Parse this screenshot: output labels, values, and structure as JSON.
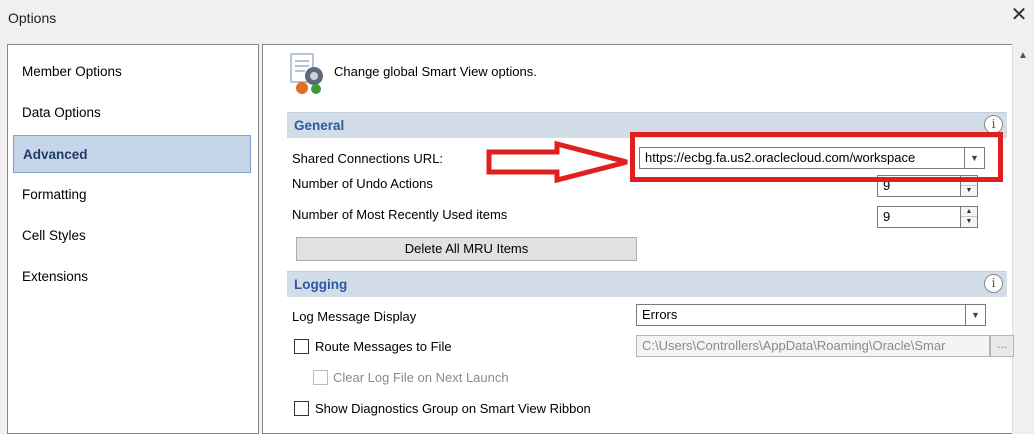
{
  "window": {
    "title": "Options"
  },
  "nav": {
    "items": [
      {
        "label": "Member Options"
      },
      {
        "label": "Data Options"
      },
      {
        "label": "Advanced"
      },
      {
        "label": "Formatting"
      },
      {
        "label": "Cell Styles"
      },
      {
        "label": "Extensions"
      }
    ],
    "selected_index": 2
  },
  "content": {
    "header_text": "Change global Smart View options.",
    "general": {
      "title": "General",
      "shared_connections_label": "Shared Connections URL:",
      "shared_connections_value": "https://ecbg.fa.us2.oraclecloud.com/workspace",
      "undo_label": "Number of Undo Actions",
      "undo_value": "9",
      "mru_label": "Number of Most Recently Used items",
      "mru_value": "9",
      "delete_mru_button": "Delete All MRU Items"
    },
    "logging": {
      "title": "Logging",
      "log_display_label": "Log Message Display",
      "log_display_value": "Errors",
      "route_label": "Route Messages to File",
      "route_checked": false,
      "route_path": "C:\\Users\\Controllers\\AppData\\Roaming\\Oracle\\Smar",
      "ellipsis": "...",
      "clear_label": "Clear Log File on Next Launch",
      "clear_checked": false,
      "diagnostics_label": "Show Diagnostics Group on Smart View Ribbon",
      "diagnostics_checked": false
    }
  },
  "colors": {
    "annotation_red": "#e02020",
    "section_header_bg": "#d3dde8",
    "section_title": "#2a5aa0",
    "selected_nav_bg": "#c6d6ea"
  },
  "icons": {
    "close": "close-icon",
    "options_header": "smart-view-options-icon",
    "info": "info-icon",
    "dropdown": "chevron-down-icon",
    "annotation_arrow": "red-arrow-icon"
  }
}
